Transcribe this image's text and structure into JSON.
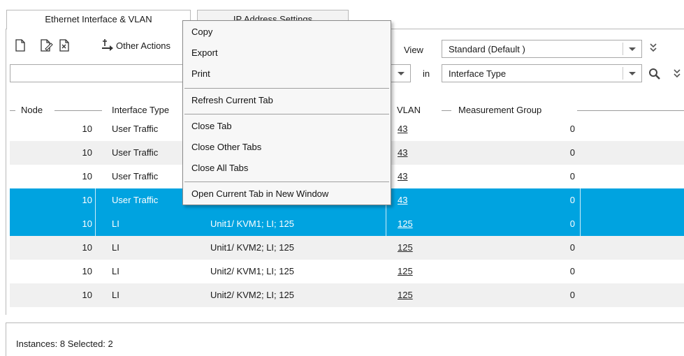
{
  "tabs": [
    {
      "label": "Ethernet Interface & VLAN",
      "active": true
    },
    {
      "label": "IP Address Settings",
      "active": false
    }
  ],
  "toolbar": {
    "icons": [
      "new-icon",
      "edit-icon",
      "delete-icon",
      "move-icon"
    ],
    "other_actions_label": "Other Actions",
    "view_label": "View",
    "view_value": "Standard (Default )",
    "in_label": "in",
    "filter_value": "",
    "filter_field_value": "Interface Type"
  },
  "table": {
    "headers": {
      "node": "Node",
      "interface_type": "Interface Type",
      "vlan": "VLAN",
      "measurement_group": "Measurement Group"
    },
    "rows": [
      {
        "node": "10",
        "type": "User Traffic",
        "name": "",
        "vlan": "43",
        "mg": "0",
        "selected": false
      },
      {
        "node": "10",
        "type": "User Traffic",
        "name": "",
        "vlan": "43",
        "mg": "0",
        "selected": false
      },
      {
        "node": "10",
        "type": "User Traffic",
        "name": "",
        "vlan": "43",
        "mg": "0",
        "selected": false
      },
      {
        "node": "10",
        "type": "User Traffic",
        "name": "",
        "vlan": "43",
        "mg": "0",
        "selected": true
      },
      {
        "node": "10",
        "type": "LI",
        "name": "Unit1/ KVM1; LI; 125",
        "vlan": "125",
        "mg": "0",
        "selected": true
      },
      {
        "node": "10",
        "type": "LI",
        "name": "Unit1/ KVM2; LI; 125",
        "vlan": "125",
        "mg": "0",
        "selected": false
      },
      {
        "node": "10",
        "type": "LI",
        "name": "Unit2/ KVM1; LI; 125",
        "vlan": "125",
        "mg": "0",
        "selected": false
      },
      {
        "node": "10",
        "type": "LI",
        "name": "Unit2/ KVM2; LI; 125",
        "vlan": "125",
        "mg": "0",
        "selected": false
      }
    ]
  },
  "status": {
    "text": "Instances: 8 Selected: 2"
  },
  "context_menu": {
    "items": [
      "Copy",
      "Export",
      "Print",
      "Refresh Current Tab",
      "Close Tab",
      "Close Other Tabs",
      "Close All Tabs",
      "Open Current Tab in New Window"
    ]
  },
  "colors": {
    "selection": "#00a3e0",
    "alt_row": "#f0f0f0"
  }
}
